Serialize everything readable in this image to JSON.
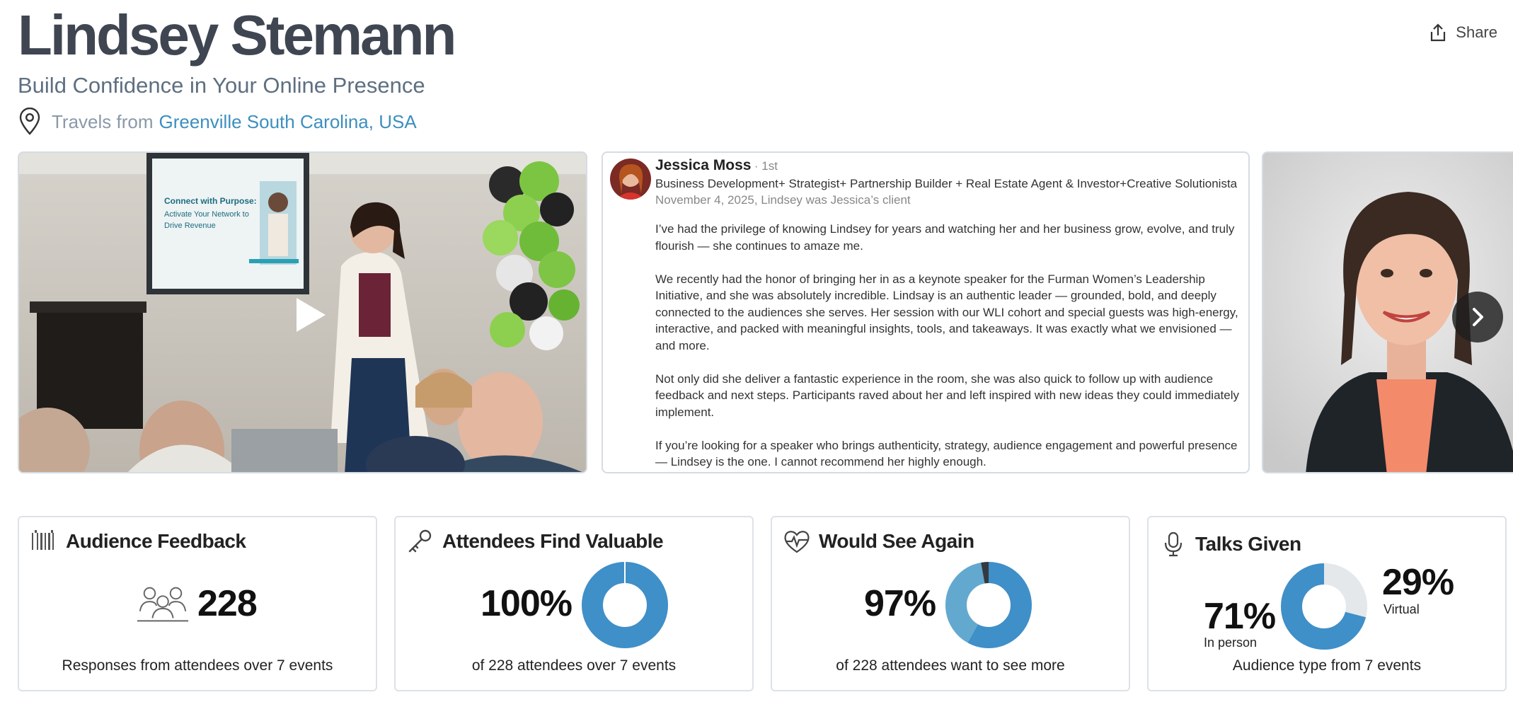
{
  "profile": {
    "name": "Lindsey Stemann",
    "tagline": "Build Confidence in Your Online Presence",
    "travels_prefix": "Travels from",
    "location": "Greenville South Carolina, USA"
  },
  "header": {
    "share_label": "Share"
  },
  "testimonial": {
    "author": "Jessica Moss",
    "degree": "· 1st",
    "author_title": "Business Development+ Strategist+ Partnership Builder + Real Estate Agent & Investor+Creative Solutionista",
    "date_line": "November 4, 2025, Lindsey was Jessica’s client",
    "paragraphs": [
      "I’ve had the privilege of knowing Lindsey for years and watching her and her business grow, evolve, and truly flourish — she continues to amaze me.",
      "We recently had the honor of bringing her in as a keynote speaker for the Furman Women’s Leadership Initiative, and she was absolutely incredible. Lindsay is an authentic leader — grounded, bold, and deeply connected to the audiences she serves. Her session with our WLI cohort and special guests was high-energy, interactive, and packed with meaningful insights, tools, and takeaways. It was exactly what we envisioned — and more.",
      "Not only did she deliver a fantastic experience in the room, she was also quick to follow up with audience feedback and next steps. Participants raved about her and left inspired with new ideas they could immediately implement.",
      "If you’re looking for a speaker who brings authenticity, strategy, audience engagement and powerful presence — Lindsey is the one. I cannot recommend her highly enough."
    ]
  },
  "video": {
    "slide_text": [
      "Connect with Purpose:",
      "Activate Your Network to",
      "Drive Revenue"
    ]
  },
  "stats": {
    "feedback": {
      "title": "Audience Feedback",
      "value": "228",
      "footer": "Responses from attendees over 7 events"
    },
    "valuable": {
      "title": "Attendees Find Valuable",
      "value": "100%",
      "percent": 100,
      "footer": "of 228 attendees over 7 events"
    },
    "see_again": {
      "title": "Would See Again",
      "value": "97%",
      "segments": [
        {
          "name": "yes-dark",
          "percent": 58,
          "color": "#3f8fc8"
        },
        {
          "name": "yes-light",
          "percent": 39,
          "color": "#63a9cf"
        },
        {
          "name": "no",
          "percent": 3,
          "color": "#333a40"
        }
      ],
      "footer": "of 228 attendees want to see more"
    },
    "talks": {
      "title": "Talks Given",
      "in_person_value": "71%",
      "in_person_label": "In person",
      "virtual_value": "29%",
      "virtual_label": "Virtual",
      "in_person_percent": 71,
      "virtual_percent": 29,
      "footer": "Audience type from 7 events"
    }
  },
  "colors": {
    "accent": "#3d8fc0",
    "donut_primary": "#3f8fc8",
    "donut_light": "#e4e8eb"
  }
}
